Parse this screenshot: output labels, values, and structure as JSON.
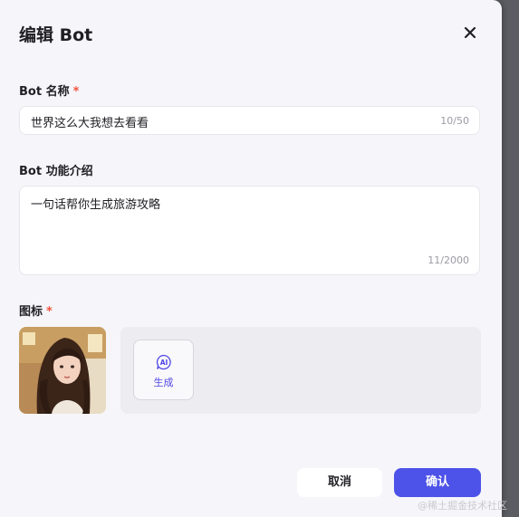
{
  "dialog": {
    "title": "编辑 Bot",
    "close_icon": "close-icon"
  },
  "name_field": {
    "label": "Bot 名称",
    "required_mark": "*",
    "value": "世界这么大我想去看看",
    "counter": "10/50"
  },
  "desc_field": {
    "label": "Bot 功能介绍",
    "value": "一句话帮你生成旅游攻略",
    "counter": "11/2000"
  },
  "icon_field": {
    "label": "图标",
    "required_mark": "*",
    "avatar": "avatar-image",
    "generate_icon": "ai-icon",
    "generate_label": "生成"
  },
  "footer": {
    "cancel_label": "取消",
    "confirm_label": "确认"
  },
  "watermark": "@稀土掘金技术社区",
  "colors": {
    "accent": "#4d53e8",
    "required": "#f1533f",
    "generate_text": "#5147e6",
    "dialog_bg": "#f6f6fa"
  }
}
